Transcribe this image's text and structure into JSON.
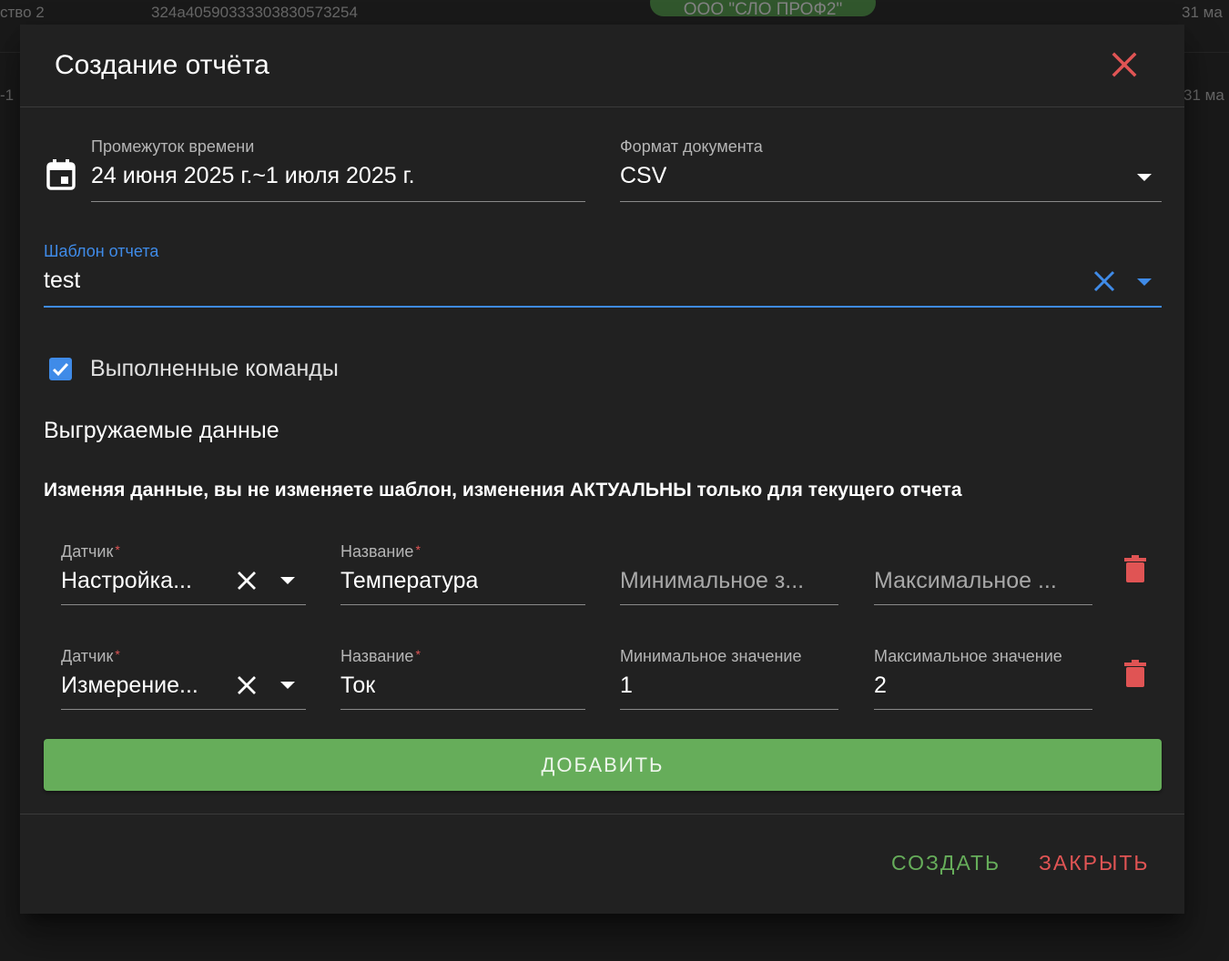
{
  "background": {
    "row1": {
      "col1": "ство 2",
      "col2": "324a405903333038305732​54",
      "chip": "ООО \"СЛО ПРОФ2\"",
      "date": "31 ма"
    },
    "row2": {
      "col1": "-1",
      "date": "31 ма"
    }
  },
  "dialog": {
    "title": "Создание отчёта",
    "period": {
      "label": "Промежуток времени",
      "value": "24 июня 2025 г.~1 июля 2025 г."
    },
    "format": {
      "label": "Формат документа",
      "value": "CSV"
    },
    "template": {
      "label": "Шаблон отчета",
      "value": "test"
    },
    "executed_commands": {
      "label": "Выполненные команды",
      "checked": true
    },
    "section_title": "Выгружаемые данные",
    "notice": "Изменяя данные, вы не изменяете шаблон, изменения АКТУАЛЬНЫ только для текущего отчета",
    "rows": [
      {
        "sensor_label": "Датчик",
        "sensor_value": "Настройка...",
        "name_label": "Название",
        "name_value": "Температура",
        "min_label": "",
        "min_placeholder": "Минимальное з...",
        "min_value": "",
        "max_label": "",
        "max_placeholder": "Максимальное ...",
        "max_value": ""
      },
      {
        "sensor_label": "Датчик",
        "sensor_value": "Измерение...",
        "name_label": "Название",
        "name_value": "Ток",
        "min_label": "Минимальное значение",
        "min_placeholder": "",
        "min_value": "1",
        "max_label": "Максимальное значение",
        "max_placeholder": "",
        "max_value": "2"
      }
    ],
    "add_button": "ДОБАВИТЬ",
    "create_button": "СОЗДАТЬ",
    "close_button": "ЗАКРЫТЬ"
  },
  "colors": {
    "accent_blue": "#3f8be8",
    "success_green": "#66ad5a",
    "danger_red": "#e05454"
  }
}
